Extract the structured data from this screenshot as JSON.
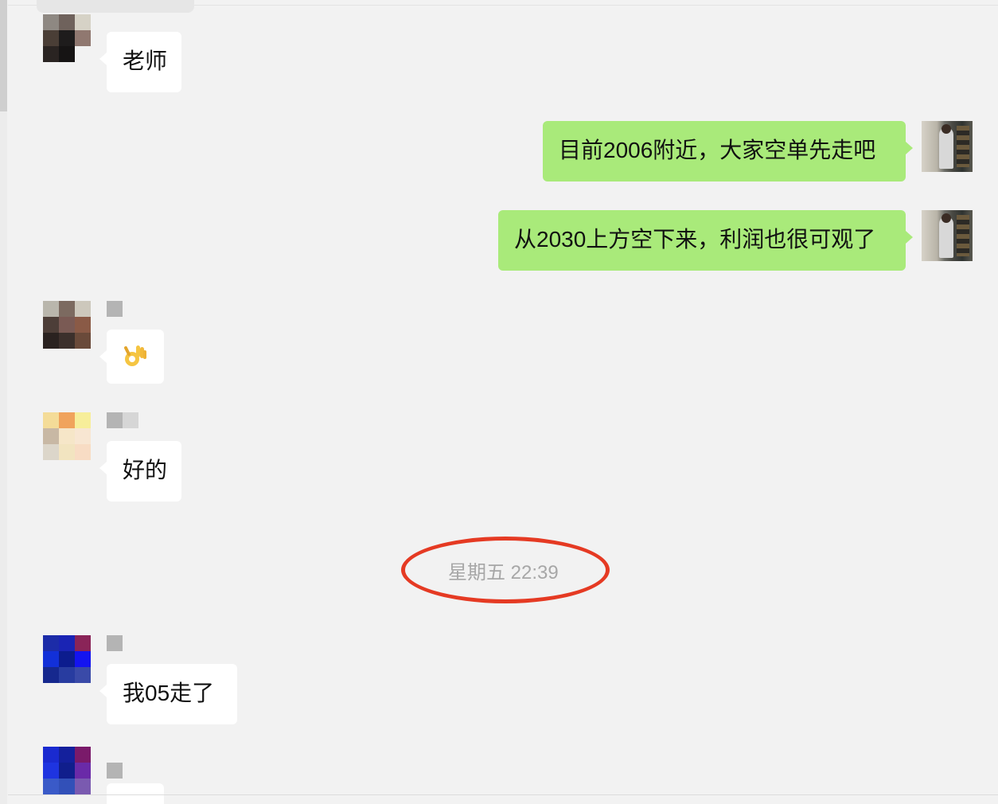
{
  "messages": [
    {
      "id": "m1",
      "direction": "incoming",
      "text": "老师"
    },
    {
      "id": "m2",
      "direction": "outgoing",
      "text": "目前2006附近，大家空单先走吧"
    },
    {
      "id": "m3",
      "direction": "outgoing",
      "text": "从2030上方空下来，利润也很可观了"
    },
    {
      "id": "m4",
      "direction": "incoming",
      "emoji": "ok-hand-icon"
    },
    {
      "id": "m5",
      "direction": "incoming",
      "text": "好的"
    },
    {
      "id": "m7",
      "direction": "incoming",
      "text": "我05走了"
    }
  ],
  "timestamp": {
    "text": "星期五 22:39",
    "highlighted": true,
    "highlight_color": "#e53a23"
  },
  "colors": {
    "background": "#f2f2f2",
    "incoming_bubble": "#ffffff",
    "outgoing_bubble": "#a9ea7a",
    "timestamp_text": "#a7a7a7"
  }
}
